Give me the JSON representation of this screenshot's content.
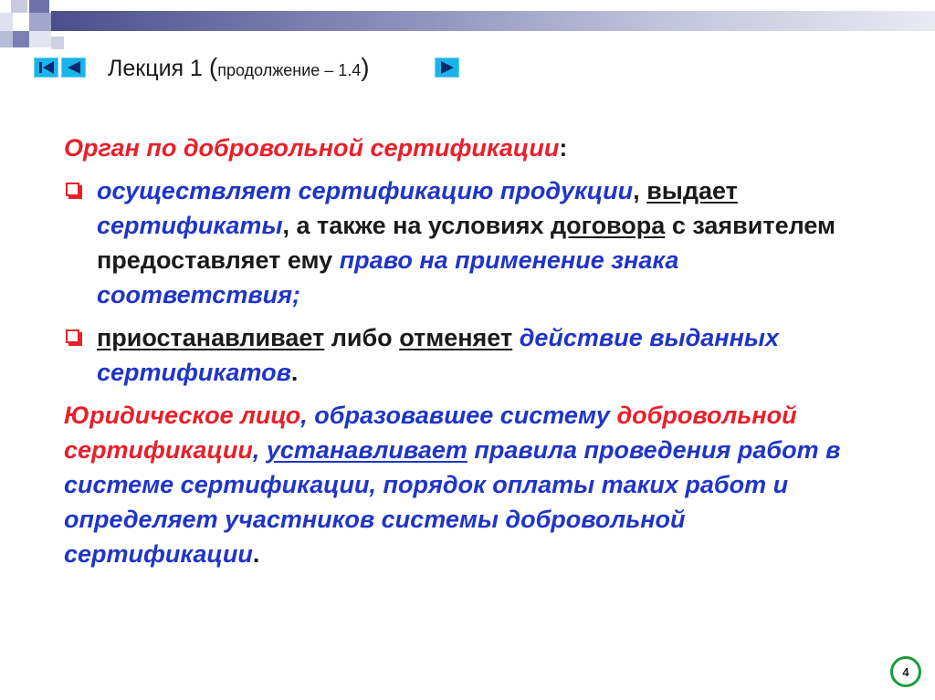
{
  "header": {
    "title_main": "Лекция 1 ",
    "title_open_paren": "(",
    "title_sub": "продолжение – 1.4",
    "title_close_paren": ")"
  },
  "nav": {
    "first_icon": "first-slide-icon",
    "prev_icon": "prev-slide-icon",
    "next_icon": "next-slide-icon",
    "button_color": "#19b4ea"
  },
  "content": {
    "heading_text": "Орган по добровольной сертификации",
    "heading_colon": ":",
    "bullet1": {
      "t1": "осуществляет сертификацию продукции",
      "t2": ", ",
      "t3": "выдает",
      "t4": " ",
      "t5": "сертификаты",
      "t6": ", а также на условиях ",
      "t7": "договора",
      "t8": " с заявителем предоставляет ему ",
      "t9": "право на применение знака соответствия;"
    },
    "bullet2": {
      "t1": "приостанавливает",
      "t2": " либо ",
      "t3": "отменяет",
      "t4": " ",
      "t5": "действие выданных сертификатов",
      "t6": "."
    },
    "para2": {
      "t1": "Юридическое лицо",
      "t2": ", образовавшее систему ",
      "t3": "добровольной сертификации",
      "t4": ", ",
      "t5": "устанавливает",
      "t6": " правила проведения работ в системе сертификации, порядок оплаты таких работ и определяет участников системы добровольной сертификации",
      "t7": "."
    }
  },
  "footer": {
    "page_number": "4"
  },
  "colors": {
    "accent_red": "#e8202a",
    "accent_blue": "#1f35c8",
    "page_circle": "#1a9b3c"
  }
}
